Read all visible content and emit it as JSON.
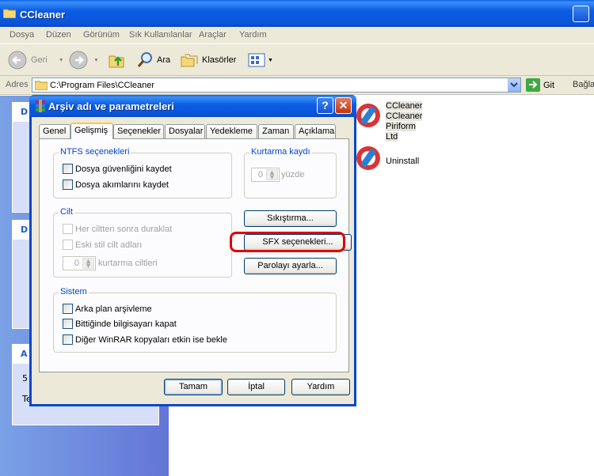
{
  "window": {
    "title": "CCleaner"
  },
  "menu": [
    "Dosya",
    "Düzen",
    "Görünüm",
    "Sık Kullanılanlar",
    "Araçlar",
    "Yardım"
  ],
  "toolbar": {
    "back": "Geri",
    "search": "Ara",
    "folders": "Klasörler"
  },
  "address": {
    "label": "Adres",
    "value": "C:\\Program Files\\CCleaner",
    "go": "Git",
    "links": "Bağla"
  },
  "side": {
    "box1_head": "D",
    "box2_head": "D",
    "box3_head": "A",
    "box3_line1": "5",
    "box3_line2": "Te"
  },
  "files": [
    {
      "name": "CCleaner",
      "line2": "CCleaner",
      "line3": "Piriform Ltd"
    },
    {
      "name": "Uninstall"
    }
  ],
  "dialog": {
    "title": "Arşiv adı ve parametreleri",
    "tabs": [
      "Genel",
      "Gelişmiş",
      "Seçenekler",
      "Dosyalar",
      "Yedekleme",
      "Zaman",
      "Açıklama"
    ],
    "active_tab": "Gelişmiş",
    "ntfs": {
      "legend": "NTFS seçenekleri",
      "opt1": "Dosya güvenliğini kaydet",
      "opt2": "Dosya akımlarını kaydet"
    },
    "recovery": {
      "legend": "Kurtarma kaydı",
      "value": "0",
      "unit": "yüzde"
    },
    "volume": {
      "legend": "Cilt",
      "opt1": "Her ciltten sonra duraklat",
      "opt2": "Eski stil cilt adları",
      "value": "0",
      "unit": "kurtarma ciltleri"
    },
    "buttons": {
      "compression": "Sıkıştırma...",
      "sfx": "SFX seçenekleri...",
      "password": "Parolayı ayarla..."
    },
    "system": {
      "legend": "Sistem",
      "opt1": "Arka plan arşivleme",
      "opt2": "Bittiğinde bilgisayarı kapat",
      "opt3": "Diğer WinRAR kopyaları etkin ise bekle"
    },
    "footer": {
      "ok": "Tamam",
      "cancel": "İptal",
      "help": "Yardım"
    },
    "help_btn": "?",
    "close_btn": "✕"
  },
  "colors": {
    "xp_blue": "#0a54d8",
    "highlight_red": "#e20000",
    "dialog_bg": "#ece9d8"
  }
}
